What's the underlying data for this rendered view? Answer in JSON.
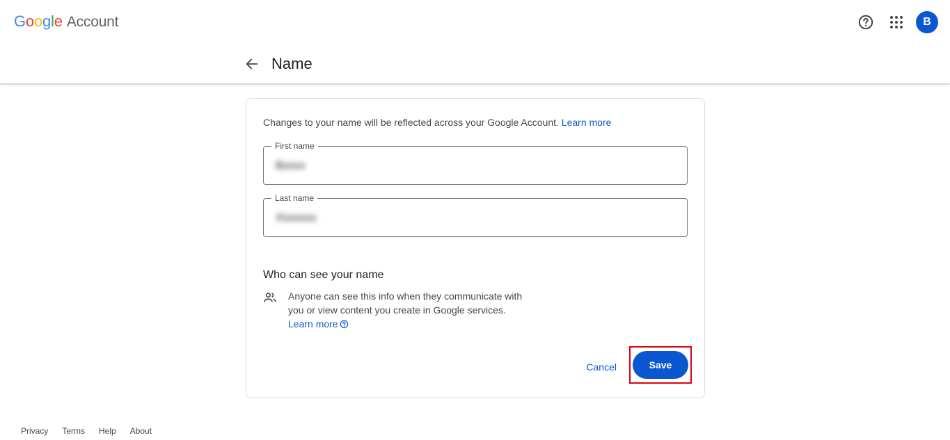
{
  "header": {
    "brand": {
      "google_letters": [
        {
          "char": "G",
          "color": "#4285F4"
        },
        {
          "char": "o",
          "color": "#EA4335"
        },
        {
          "char": "o",
          "color": "#FBBC05"
        },
        {
          "char": "g",
          "color": "#4285F4"
        },
        {
          "char": "l",
          "color": "#34A853"
        },
        {
          "char": "e",
          "color": "#EA4335"
        }
      ],
      "product": "Account"
    },
    "icons": [
      "help-icon",
      "apps-grid-icon"
    ],
    "avatar_initial": "B",
    "avatar_color": "#0b57d0"
  },
  "subheader": {
    "back_icon": "arrow-left-icon",
    "title": "Name"
  },
  "card": {
    "intro_text": "Changes to your name will be reflected across your Google Account.",
    "intro_link": "Learn more",
    "first_name": {
      "label": "First name",
      "value": "Bxxxx"
    },
    "last_name": {
      "label": "Last name",
      "value": "Xxxxxxx"
    },
    "visibility": {
      "title": "Who can see your name",
      "icon": "people-icon",
      "text_line1": "Anyone can see this info when they communicate with",
      "text_line2": "you or view content you create in Google services.",
      "link": "Learn more",
      "link_icon": "help-circle-icon"
    },
    "actions": {
      "cancel_label": "Cancel",
      "save_label": "Save",
      "highlight_color": "#e0000f"
    }
  },
  "footer": {
    "links": [
      "Privacy",
      "Terms",
      "Help",
      "About"
    ]
  },
  "colors": {
    "accent": "#0b57d0",
    "text_primary": "#1f1f1f",
    "text_secondary": "#444746",
    "border": "#dadce0"
  }
}
